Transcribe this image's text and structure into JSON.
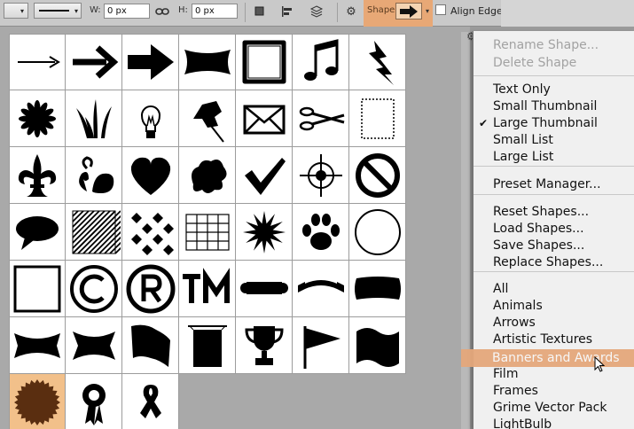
{
  "options_bar": {
    "w_label": "W:",
    "w_value": "0 px",
    "h_label": "H:",
    "h_value": "0 px",
    "shape_label": "Shape:",
    "align_edges_label": "Align Edges"
  },
  "shapes": [
    [
      "arrow-thin-icon",
      "arrow-bold-icon",
      "arrow-heavy-icon",
      "banner-bow-icon",
      "frame-rough-icon",
      "music-notes-icon",
      "lightning-icon"
    ],
    [
      "flower-burst-icon",
      "grass-icon",
      "light-bulb-icon",
      "push-pin-icon",
      "envelope-icon",
      "scissors-icon",
      "stamp-frame-icon"
    ],
    [
      "fleur-de-lis-icon",
      "ornament-icon",
      "heart-icon",
      "blob-icon",
      "checkmark-icon",
      "target-icon",
      "no-symbol-icon"
    ],
    [
      "speech-bubble-icon",
      "stripes-icon",
      "checker-diamonds-icon",
      "grid-icon",
      "starburst-icon",
      "paw-print-icon",
      "circle-frame-icon"
    ],
    [
      "square-frame-icon",
      "copyright-icon",
      "registered-icon",
      "trademark-icon",
      "scroll-banner-icon",
      "ribbon-banner-icon",
      "wavy-banner-icon"
    ],
    [
      "curved-banner-icon",
      "bow-banner-icon",
      "flag-wave-icon",
      "hanging-banner-icon",
      "trophy-icon",
      "pennant-icon",
      "flag-icon"
    ],
    [
      "seal-icon",
      "award-ribbon-icon",
      "awareness-ribbon-icon"
    ]
  ],
  "menu": {
    "items": [
      {
        "label": "Rename Shape...",
        "disabled": true
      },
      {
        "label": "Delete Shape",
        "disabled": true
      },
      {
        "label": "Text Only"
      },
      {
        "label": "Small Thumbnail"
      },
      {
        "label": "Large Thumbnail",
        "checked": true
      },
      {
        "label": "Small List"
      },
      {
        "label": "Large List"
      },
      {
        "label": "Preset Manager..."
      },
      {
        "label": "Reset Shapes..."
      },
      {
        "label": "Load Shapes..."
      },
      {
        "label": "Save Shapes..."
      },
      {
        "label": "Replace Shapes..."
      },
      {
        "label": "All"
      },
      {
        "label": "Animals"
      },
      {
        "label": "Arrows"
      },
      {
        "label": "Artistic Textures"
      },
      {
        "label": "Banners and Awards",
        "highlighted": true
      },
      {
        "label": "Film"
      },
      {
        "label": "Frames"
      },
      {
        "label": "Grime Vector Pack"
      },
      {
        "label": "LightBulb"
      }
    ]
  },
  "colors": {
    "highlight": "#e4a67a",
    "selected_cell": "#f2c08a",
    "seal": "#5a2e10"
  }
}
